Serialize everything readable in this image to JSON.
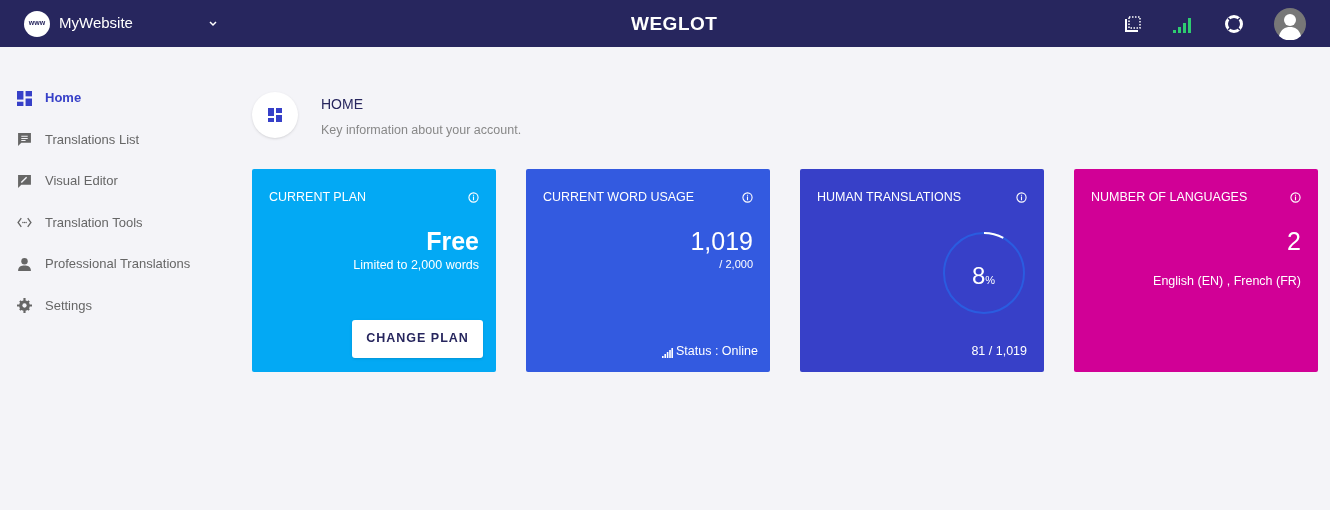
{
  "topbar": {
    "site_icon_text": "www",
    "site_name": "MyWebsite",
    "logo": "WEGLOT"
  },
  "sidebar": {
    "items": [
      {
        "label": "Home",
        "selected": true
      },
      {
        "label": "Translations List",
        "selected": false
      },
      {
        "label": "Visual Editor",
        "selected": false
      },
      {
        "label": "Translation Tools",
        "selected": false
      },
      {
        "label": "Professional Translations",
        "selected": false
      },
      {
        "label": "Settings",
        "selected": false
      }
    ]
  },
  "page_header": {
    "title": "HOME",
    "subtitle": "Key information about your account."
  },
  "cards": [
    {
      "kind": "plan",
      "title": "CURRENT PLAN",
      "color": "#03a9f4",
      "value": "Free",
      "detail": "Limited to 2,000 words",
      "button": "CHANGE PLAN"
    },
    {
      "kind": "usage",
      "title": "CURRENT WORD USAGE",
      "color": "#335ae0",
      "value": "1,019",
      "detail": "/ 2,000",
      "status": "Status : Online"
    },
    {
      "kind": "human",
      "title": "HUMAN TRANSLATIONS",
      "color": "#3740c8",
      "level": 0.08,
      "value": "8",
      "unit": "%",
      "detail": "81 / 1,019"
    },
    {
      "kind": "languages",
      "title": "NUMBER OF LANGUAGES",
      "color": "#d10096",
      "value": "2",
      "detail": "English (EN) , French (FR)"
    }
  ]
}
